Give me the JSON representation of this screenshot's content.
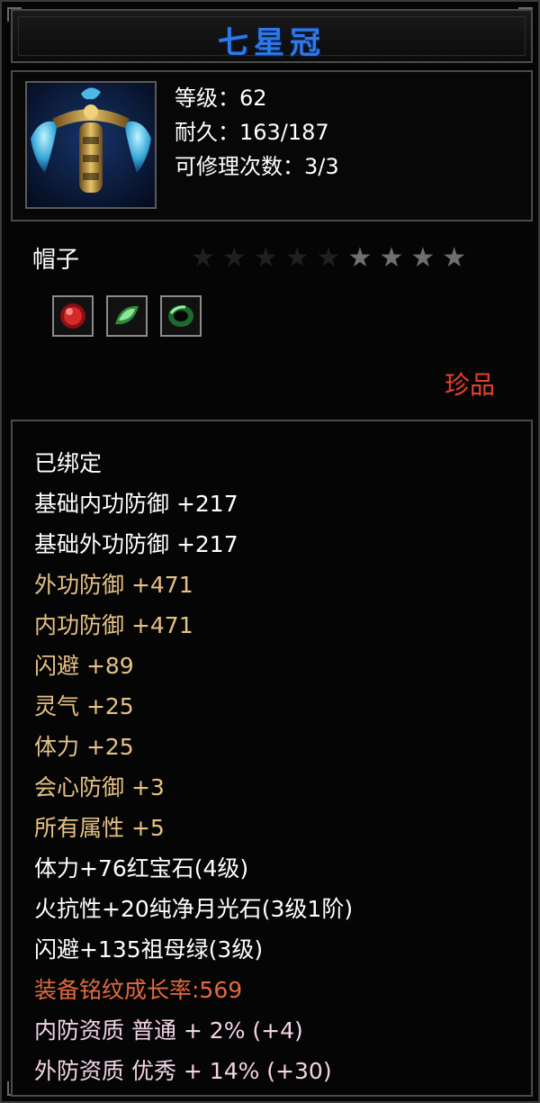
{
  "item": {
    "name": "七星冠",
    "stats": {
      "level": "等级：62",
      "durability": "耐久：163/187",
      "repair_count": "可修理次数：3/3"
    },
    "type": "帽子",
    "stars": {
      "total": 9,
      "lit": 4
    },
    "gems": [
      {
        "icon": "ruby-gem-icon",
        "color": "#d42a2a"
      },
      {
        "icon": "moonstone-gem-icon",
        "color": "#58c36a"
      },
      {
        "icon": "emerald-gem-icon",
        "color": "#2d9a4a"
      }
    ],
    "rarity": "珍品"
  },
  "attributes": [
    {
      "text": "已绑定",
      "color": "white"
    },
    {
      "text": "基础内功防御 +217",
      "color": "white"
    },
    {
      "text": "基础外功防御 +217",
      "color": "white"
    },
    {
      "text": "外功防御 +471",
      "color": "gold"
    },
    {
      "text": "内功防御 +471",
      "color": "gold"
    },
    {
      "text": "闪避 +89",
      "color": "gold"
    },
    {
      "text": "灵气 +25",
      "color": "gold"
    },
    {
      "text": "体力 +25",
      "color": "gold"
    },
    {
      "text": "会心防御 +3",
      "color": "gold"
    },
    {
      "text": "所有属性 +5",
      "color": "gold"
    },
    {
      "text": "体力+76红宝石(4级)",
      "color": "white"
    },
    {
      "text": "火抗性+20纯净月光石(3级1阶)",
      "color": "white"
    },
    {
      "text": "闪避+135祖母绿(3级)",
      "color": "white"
    },
    {
      "text": "装备铭纹成长率:569",
      "color": "orange"
    },
    {
      "text": "内防资质 普通 + 2% (+4)",
      "color": "pink"
    },
    {
      "text": "外防资质 优秀 + 14% (+30)",
      "color": "pink"
    }
  ],
  "colors": {
    "title": "#2f78e8",
    "rarity": "#e8402c",
    "gold": "#e6c183",
    "orange": "#e06a3e",
    "pink": "#f3d4e6"
  }
}
